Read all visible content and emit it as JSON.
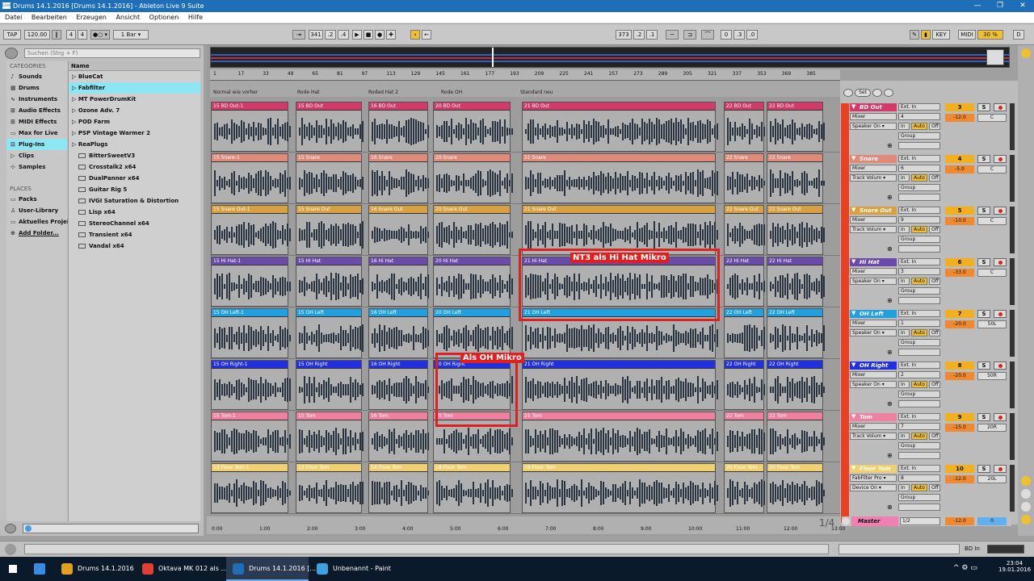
{
  "titlebar": {
    "title": "Drums 14.1.2016  [Drums 14.1.2016] - Ableton Live 9 Suite",
    "logo": "Live",
    "min": "—",
    "max": "❐",
    "close": "✕"
  },
  "menu": [
    "Datei",
    "Bearbeiten",
    "Erzeugen",
    "Ansicht",
    "Optionen",
    "Hilfe"
  ],
  "control": {
    "tap": "TAP",
    "tempo": "120.00",
    "sig_num": "4",
    "sig_den": "4",
    "quant": "1 Bar ▾",
    "arr_pos": [
      "341",
      ".2",
      ".4"
    ],
    "loop_start": [
      "373",
      ".2",
      ".1"
    ],
    "loop_len": [
      "0",
      ".3",
      ".0"
    ],
    "key": "KEY",
    "midi": "MIDI",
    "cpu": "30 %",
    "d": "D"
  },
  "browser": {
    "search_placeholder": "Suchen (Strg + F)",
    "categories_title": "CATEGORIES",
    "categories": [
      {
        "label": "Sounds",
        "icon": "♪"
      },
      {
        "label": "Drums",
        "icon": "▦"
      },
      {
        "label": "Instruments",
        "icon": "∿"
      },
      {
        "label": "Audio Effects",
        "icon": "⊞"
      },
      {
        "label": "MIDI Effects",
        "icon": "⊞"
      },
      {
        "label": "Max for Live",
        "icon": "▭"
      },
      {
        "label": "Plug-Ins",
        "icon": "⊡",
        "selected": true
      },
      {
        "label": "Clips",
        "icon": "▷"
      },
      {
        "label": "Samples",
        "icon": "⊹"
      }
    ],
    "places_title": "PLACES",
    "places": [
      {
        "label": "Packs",
        "icon": "▭"
      },
      {
        "label": "User-Library",
        "icon": "♙"
      },
      {
        "label": "Aktuelles Projekt",
        "icon": "▭"
      },
      {
        "label": "Add Folder...",
        "icon": "⊕"
      }
    ],
    "name_header": "Name",
    "items": [
      {
        "label": "BlueCat",
        "type": "folder"
      },
      {
        "label": "Fabfilter",
        "type": "folder",
        "selected": true
      },
      {
        "label": "MT PowerDrumKit",
        "type": "folder"
      },
      {
        "label": "Ozone Adv. 7",
        "type": "folder"
      },
      {
        "label": "POD Farm",
        "type": "folder"
      },
      {
        "label": "PSP Vintage Warmer 2",
        "type": "folder"
      },
      {
        "label": "ReaPlugs",
        "type": "folder"
      },
      {
        "label": "BitterSweetV3",
        "type": "plugin"
      },
      {
        "label": "Crosstalk2 x64",
        "type": "plugin"
      },
      {
        "label": "DualPanner x64",
        "type": "plugin"
      },
      {
        "label": "Guitar Rig 5",
        "type": "plugin"
      },
      {
        "label": "IVGI Saturation & Distortion",
        "type": "plugin"
      },
      {
        "label": "Lisp x64",
        "type": "plugin"
      },
      {
        "label": "StereoChannel x64",
        "type": "plugin"
      },
      {
        "label": "Transient x64",
        "type": "plugin"
      },
      {
        "label": "Vandal x64",
        "type": "plugin"
      }
    ]
  },
  "ruler": [
    "1",
    "17",
    "33",
    "49",
    "65",
    "81",
    "97",
    "113",
    "129",
    "145",
    "161",
    "177",
    "193",
    "209",
    "225",
    "241",
    "257",
    "273",
    "289",
    "305",
    "321",
    "337",
    "353",
    "369",
    "385"
  ],
  "locators": [
    "Normal wie vorher",
    "Rode Hat",
    "Roded Hat 2",
    "Rode OH",
    "Standard neu"
  ],
  "timeline": [
    "0:00",
    "1:00",
    "2:00",
    "3:00",
    "4:00",
    "5:00",
    "6:00",
    "7:00",
    "8:00",
    "9:00",
    "10:00",
    "11:00",
    "12:00",
    "13:00"
  ],
  "page_indicator": "1/4",
  "set_label": "Set",
  "tracks": [
    {
      "name": "BD Out",
      "color": "#d23a6a",
      "clips": [
        "15 BD Out-1",
        "15 BD Out",
        "16 BD Out",
        "20 BD Out",
        "21 BD Out",
        "22 BD Out",
        "22 BD Out"
      ],
      "input": "Ext. In",
      "chan": "4",
      "out": "Speaker On ▾",
      "io": "Mixer",
      "num": "3",
      "vol": "-12.0",
      "pan": "C"
    },
    {
      "name": "Snare",
      "color": "#e08a7a",
      "clips": [
        "15 Snare-1",
        "15 Snare",
        "16 Snare",
        "20 Snare",
        "21 Snare",
        "22 Snare",
        "22 Snare"
      ],
      "input": "Ext. In",
      "chan": "6",
      "out": "Track Volum ▾",
      "io": "Mixer",
      "num": "4",
      "vol": "-5.0",
      "pan": "C"
    },
    {
      "name": "Snare Out",
      "color": "#d8a040",
      "clips": [
        "15 Snare Out-1",
        "15 Snare Out",
        "16 Snare Out",
        "20 Snare Out",
        "21 Snare Out",
        "22 Snare Out",
        "22 Snare Out"
      ],
      "input": "Ext. In",
      "chan": "9",
      "out": "Track Volum ▾",
      "io": "Mixer",
      "num": "5",
      "vol": "-10.0",
      "pan": "C"
    },
    {
      "name": "Hi Hat",
      "color": "#6a4aaa",
      "clips": [
        "15 Hi Hat-1",
        "15 Hi Hat",
        "16 Hi Hat",
        "20 Hi Hat",
        "21 Hi Hat",
        "22 Hi Hat",
        "22 Hi Hat"
      ],
      "input": "Ext. In",
      "chan": "3",
      "out": "Speaker On ▾",
      "io": "Mixer",
      "num": "6",
      "vol": "-33.0",
      "pan": "C"
    },
    {
      "name": "OH Left",
      "color": "#20a0e0",
      "clips": [
        "15 OH Left-1",
        "15 OH Left",
        "16 OH Left",
        "20 OH Left",
        "21 OH Left",
        "22 OH Left",
        "22 OH Left"
      ],
      "input": "Ext. In",
      "chan": "1",
      "out": "Speaker On ▾",
      "io": "Mixer",
      "num": "7",
      "vol": "-20.0",
      "pan": "50L"
    },
    {
      "name": "OH Right",
      "color": "#2030e0",
      "clips": [
        "15 OH Right-1",
        "15 OH Right",
        "16 OH Right",
        "20 OH Right",
        "21 OH Right",
        "22 OH Right",
        "22 OH Right"
      ],
      "input": "Ext. In",
      "chan": "2",
      "out": "Speaker On ▾",
      "io": "Mixer",
      "num": "8",
      "vol": "-20.0",
      "pan": "50R"
    },
    {
      "name": "Tom",
      "color": "#f080a0",
      "clips": [
        "15 Tom-1",
        "15 Tom",
        "16 Tom",
        "20 Tom",
        "21 Tom",
        "22 Tom",
        "22 Tom"
      ],
      "input": "Ext. In",
      "chan": "7",
      "out": "Track Volum ▾",
      "io": "Mixer",
      "num": "9",
      "vol": "-15.0",
      "pan": "20R"
    },
    {
      "name": "Floor Tom",
      "color": "#f0d070",
      "clips": [
        "13 Floor Tom-1",
        "13 Floor Tom",
        "14 Floor Tom",
        "18 Floor Tom",
        "19 Floor Tom",
        "20 Floor Tom",
        "20 Floor Tom"
      ],
      "input": "Ext. In",
      "chan": "8",
      "out": "Device On ▾",
      "io": "FabFilter Pro ▾",
      "num": "10",
      "vol": "-12.0",
      "pan": "20L"
    }
  ],
  "mixer_labels": {
    "in": "In",
    "auto": "Auto",
    "off": "Off",
    "group": "Group",
    "solo": "S"
  },
  "master": {
    "name": "Master",
    "routing": "1/2",
    "vol": "-12.0",
    "num": "0"
  },
  "annotations": [
    {
      "text": "NT3 als Hi Hat Mikro"
    },
    {
      "text": "Als OH Mikro"
    }
  ],
  "status": {
    "track": "BD In"
  },
  "taskbar": {
    "items": [
      {
        "label": "Drums 14.1.2016",
        "color": "#e0a020"
      },
      {
        "label": "Oktava MK 012 als ...",
        "color": "#e04030"
      },
      {
        "label": "Drums 14.1.2016  [...",
        "color": "#1e6fb8",
        "active": true
      },
      {
        "label": "Unbenannt - Paint",
        "color": "#40a0e0"
      }
    ],
    "time": "23:04",
    "date": "19.01.2016"
  },
  "colors": {
    "accent": "#8ee6f2",
    "track_strip": "#e84020",
    "annotation": "#e02020"
  }
}
